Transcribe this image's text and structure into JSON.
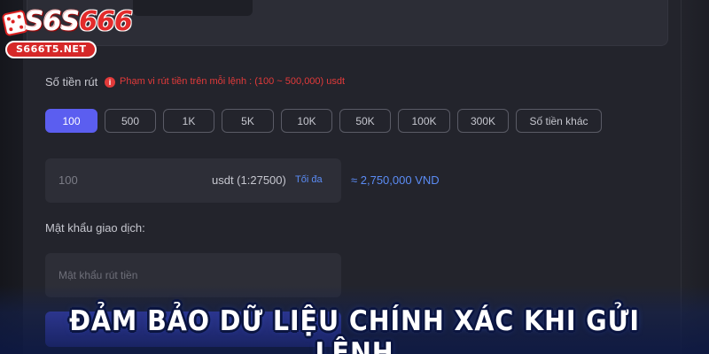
{
  "brand": {
    "logo_text_white": "S6S",
    "logo_text_red": "666",
    "domain": "S666T5.NET"
  },
  "withdraw": {
    "amount_label": "Số tiền rút",
    "amount_hint": "Phạm vi rút tiền trên mỗi lệnh : (100 ~ 500,000) usdt",
    "presets": [
      "100",
      "500",
      "1K",
      "5K",
      "10K",
      "50K",
      "100K",
      "300K",
      "Số tiền khác"
    ],
    "selected_preset": "100",
    "amount_value": "100",
    "amount_unit": "usdt (1:27500)",
    "max_label": "Tối đa",
    "converted": "≈ 2,750,000 VND",
    "password_label": "Mật khẩu giao dịch:",
    "password_placeholder": "Mật khẩu rút tiền"
  },
  "banner": {
    "text": "ĐẢM BẢO DỮ LIỆU CHÍNH XÁC KHI GỬI LỆNH"
  },
  "colors": {
    "accent": "#5b5ef0",
    "link": "#5b8cf5",
    "warning": "#e23a3a",
    "background": "#23242c"
  }
}
